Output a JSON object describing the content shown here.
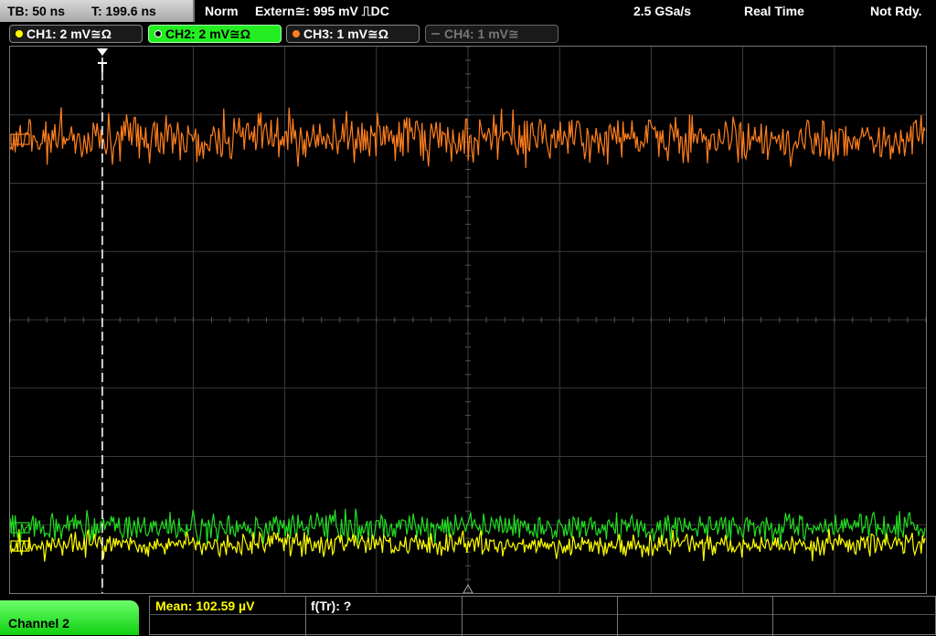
{
  "topbar": {
    "timebase": "TB: 50 ns",
    "trigger_time": "T: 199.6 ns",
    "mode": "Norm",
    "trigger_source": "Extern≅: 995 mV ⎍DC",
    "sample_rate": "2.5 GSa/s",
    "acq_mode": "Real Time",
    "status": "Not Rdy."
  },
  "channels": [
    {
      "label": "CH1: 2 mV≅Ω",
      "color": "#ffff00",
      "active": false
    },
    {
      "label": "CH2: 2 mV≅Ω",
      "color": "#22ee22",
      "active": true
    },
    {
      "label": "CH3: 1 mV≅Ω",
      "color": "#ff7f1e",
      "active": false
    },
    {
      "label": "CH4: 1 mV≅",
      "color": "#777777",
      "active": false
    }
  ],
  "bottom": {
    "selected_channel": "Channel 2",
    "mean": "Mean: 102.59 µV",
    "freq": "f(Tr): ?"
  },
  "colors": {
    "ch1": "#ffff00",
    "ch2": "#22dd22",
    "ch3": "#ff7f1e",
    "grid": "#3a3a3a"
  },
  "icons": {
    "trigger_marker": "trigger-T-icon",
    "bottom_marker": "triangle-up-icon"
  }
}
